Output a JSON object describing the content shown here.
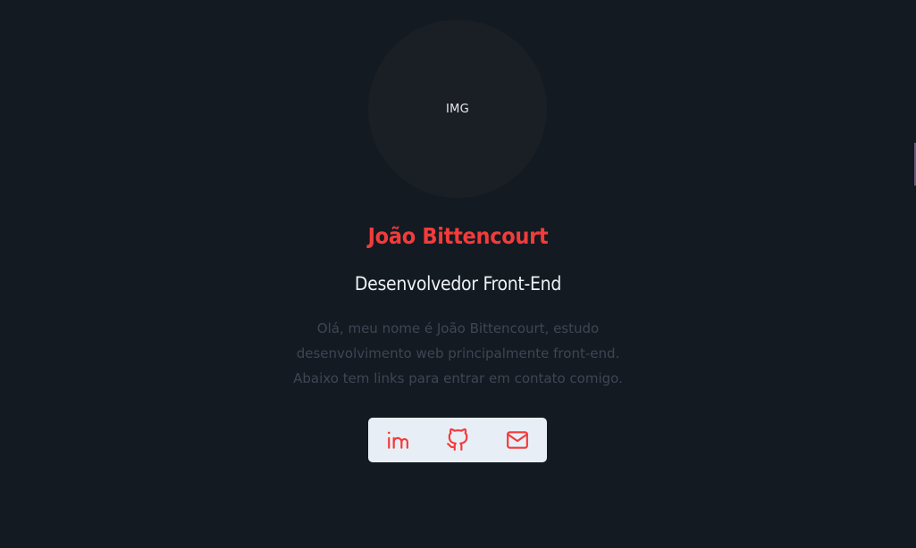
{
  "profile": {
    "avatar_label": "IMG",
    "name": "João Bittencourt",
    "role": "Desenvolvedor Front-End",
    "bio_lines": [
      "Olá, meu nome é João Bittencourt, estudo",
      "desenvolvimento web principalmente front-end.",
      "Abaixo tem links para entrar em contato comigo."
    ]
  },
  "links": [
    {
      "icon": "linkedin-icon"
    },
    {
      "icon": "github-icon"
    },
    {
      "icon": "mail-icon"
    }
  ],
  "colors": {
    "background": "#131a21",
    "avatar_bg": "#1a1e25",
    "accent": "#f23b3b",
    "heading": "#eef1f5",
    "muted_text": "#3d4653",
    "links_bar": "#e8eef6"
  }
}
